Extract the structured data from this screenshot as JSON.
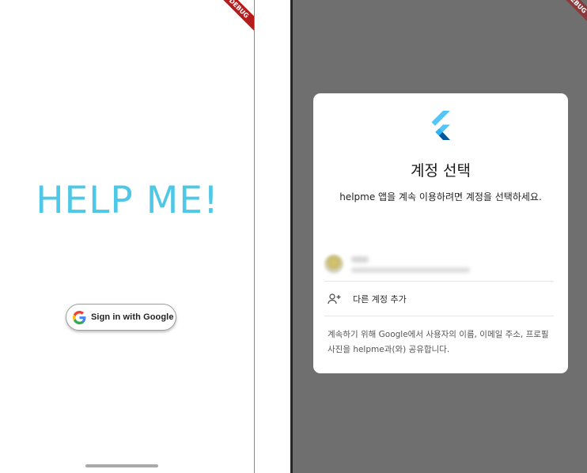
{
  "left_screen": {
    "title": "HELP ME!",
    "sign_in_button": {
      "label": "Sign in with Google"
    },
    "debug_banner": "DEBUG"
  },
  "right_screen": {
    "debug_banner": "DEBUG",
    "dialog": {
      "title": "계정 선택",
      "subtitle": "helpme 앱을 계속 이용하려면 계정을 선택하세요.",
      "add_account_label": "다른 계정 추가",
      "footer": "계속하기 위해 Google에서 사용자의 이름, 이메일 주소, 프로필 사진을 helpme과(와) 공유합니다."
    }
  },
  "colors": {
    "title_color": "#4ec8e6",
    "overlay": "#6f6f6f",
    "dialog_bg": "#ffffff"
  },
  "icons": [
    "google-g-icon",
    "flutter-logo-icon",
    "person-add-icon"
  ]
}
